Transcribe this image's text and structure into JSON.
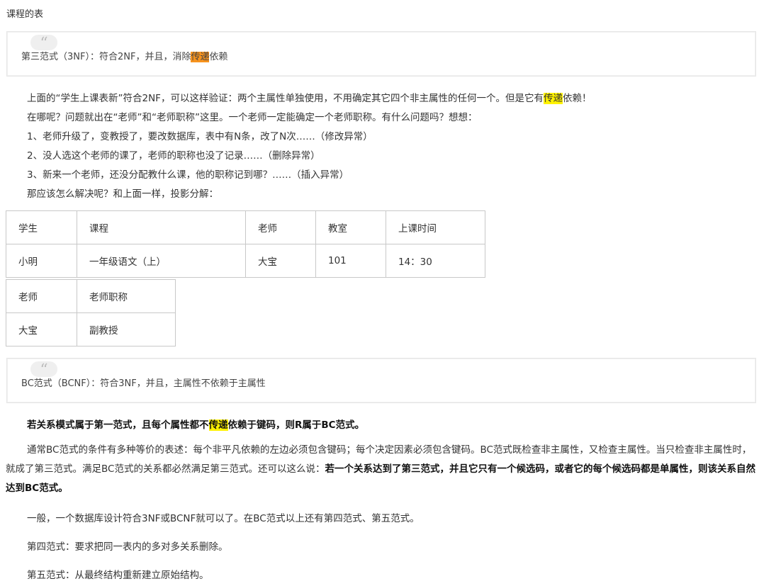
{
  "caption": "课程的表",
  "quote1": {
    "before": "第三范式（3NF）：符合2NF，并且，消除",
    "highlight": "传递",
    "after": "依赖"
  },
  "lines": {
    "l1_before": "上面的“学生上课表新”符合2NF，可以这样验证：两个主属性单独使用，不用确定其它四个非主属性的任何一个。但是它有",
    "l1_highlight": "传递",
    "l1_after": "依赖！",
    "l2": "在哪呢？问题就出在“老师”和“老师职称”这里。一个老师一定能确定一个老师职称。有什么问题吗？想想：",
    "l3": "1、老师升级了，变教授了，要改数据库，表中有N条，改了N次……（修改异常）",
    "l4": "2、没人选这个老师的课了，老师的职称也没了记录……（删除异常）",
    "l5": "3、新来一个老师，还没分配教什么课，他的职称记到哪？……（插入异常）",
    "l6": "那应该怎么解决呢？和上面一样，投影分解："
  },
  "table1": {
    "headers": [
      "学生",
      "课程",
      "老师",
      "教室",
      "上课时间"
    ],
    "row": [
      "小明",
      "一年级语文（上）",
      "大宝",
      "101",
      "14：30"
    ]
  },
  "table2": {
    "headers": [
      "老师",
      "老师职称"
    ],
    "row": [
      "大宝",
      "副教授"
    ]
  },
  "quote2": {
    "text": "BC范式（BCNF）：符合3NF，并且，主属性不依赖于主属性"
  },
  "bold_line": {
    "before": "若关系模式属于第一范式，且每个属性都不",
    "highlight": "传递",
    "after": "依赖于键码，则R属于BC范式。"
  },
  "para1": {
    "normal": "通常BC范式的条件有多种等价的表述：每个非平凡依赖的左边必须包含键码；每个决定因素必须包含键码。BC范式既检查非主属性，又检查主属性。当只检查非主属性时，就成了第三范式。满足BC范式的关系都必然满足第三范式。还可以这么说：",
    "bold": "若一个关系达到了第三范式，并且它只有一个候选码，或者它的每个候选码都是单属性，则该关系自然达到BC范式。"
  },
  "para2": "一般，一个数据库设计符合3NF或BCNF就可以了。在BC范式以上还有第四范式、第五范式。",
  "para3": "第四范式：要求把同一表内的多对多关系删除。",
  "para4": "第五范式：从最终结构重新建立原始结构。",
  "colors": {
    "highlight_yellow": "#fff200",
    "highlight_orange": "#f7931e",
    "border": "#c8c8c8"
  },
  "icons": {
    "quote": "quote-mark-icon"
  }
}
